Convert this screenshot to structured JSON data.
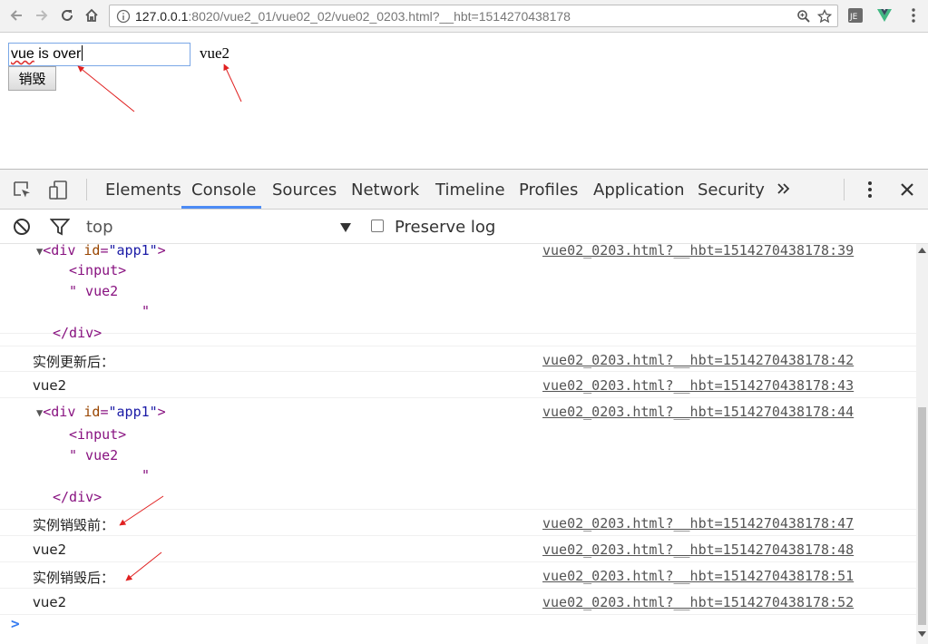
{
  "browser": {
    "url_host": "127.0.0.1",
    "url_rest": ":8020/vue2_01/vue02_02/vue02_0203.html?__hbt=1514270438178"
  },
  "page": {
    "input_value_main": "vue",
    "input_value_rest": " is over",
    "text": "vue2",
    "destroy_button": "销毁"
  },
  "devtools": {
    "tabs": [
      "Elements",
      "Console",
      "Sources",
      "Network",
      "Timeline",
      "Profiles",
      "Application",
      "Security"
    ],
    "active_tab": "Console",
    "context": "top",
    "preserve_log": "Preserve log"
  },
  "console": {
    "dom1": {
      "open": "<div id=\"app1\">",
      "tag": "div",
      "attr": "id",
      "value": "\"app1\"",
      "input": "<input>",
      "text1": "\" vue2",
      "text2": "\"",
      "close": "</div>"
    },
    "dom2": {
      "open": "<div id=\"app1\">",
      "tag": "div",
      "attr": "id",
      "value": "\"app1\"",
      "input": "<input>",
      "text1": "\" vue2",
      "text2": "\"",
      "close": "</div>"
    },
    "messages": [
      {
        "text": "实例更新后：",
        "source": "vue02_0203.html?__hbt=1514270438178:42"
      },
      {
        "text": "vue2",
        "source": "vue02_0203.html?__hbt=1514270438178:43"
      },
      {
        "text": "实例销毁前：",
        "source": "vue02_0203.html?__hbt=1514270438178:47"
      },
      {
        "text": "vue2",
        "source": "vue02_0203.html?__hbt=1514270438178:48"
      },
      {
        "text": "实例销毁后：",
        "source": "vue02_0203.html?__hbt=1514270438178:51"
      },
      {
        "text": "vue2",
        "source": "vue02_0203.html?__hbt=1514270438178:52"
      }
    ],
    "source_dom1": "vue02_0203.html?__hbt=1514270438178:39",
    "source_dom2": "vue02_0203.html?__hbt=1514270438178:44",
    "prompt": ">"
  },
  "colors": {
    "annotation_arrow": "#e02020",
    "active_tab": "#4c8bf5"
  }
}
